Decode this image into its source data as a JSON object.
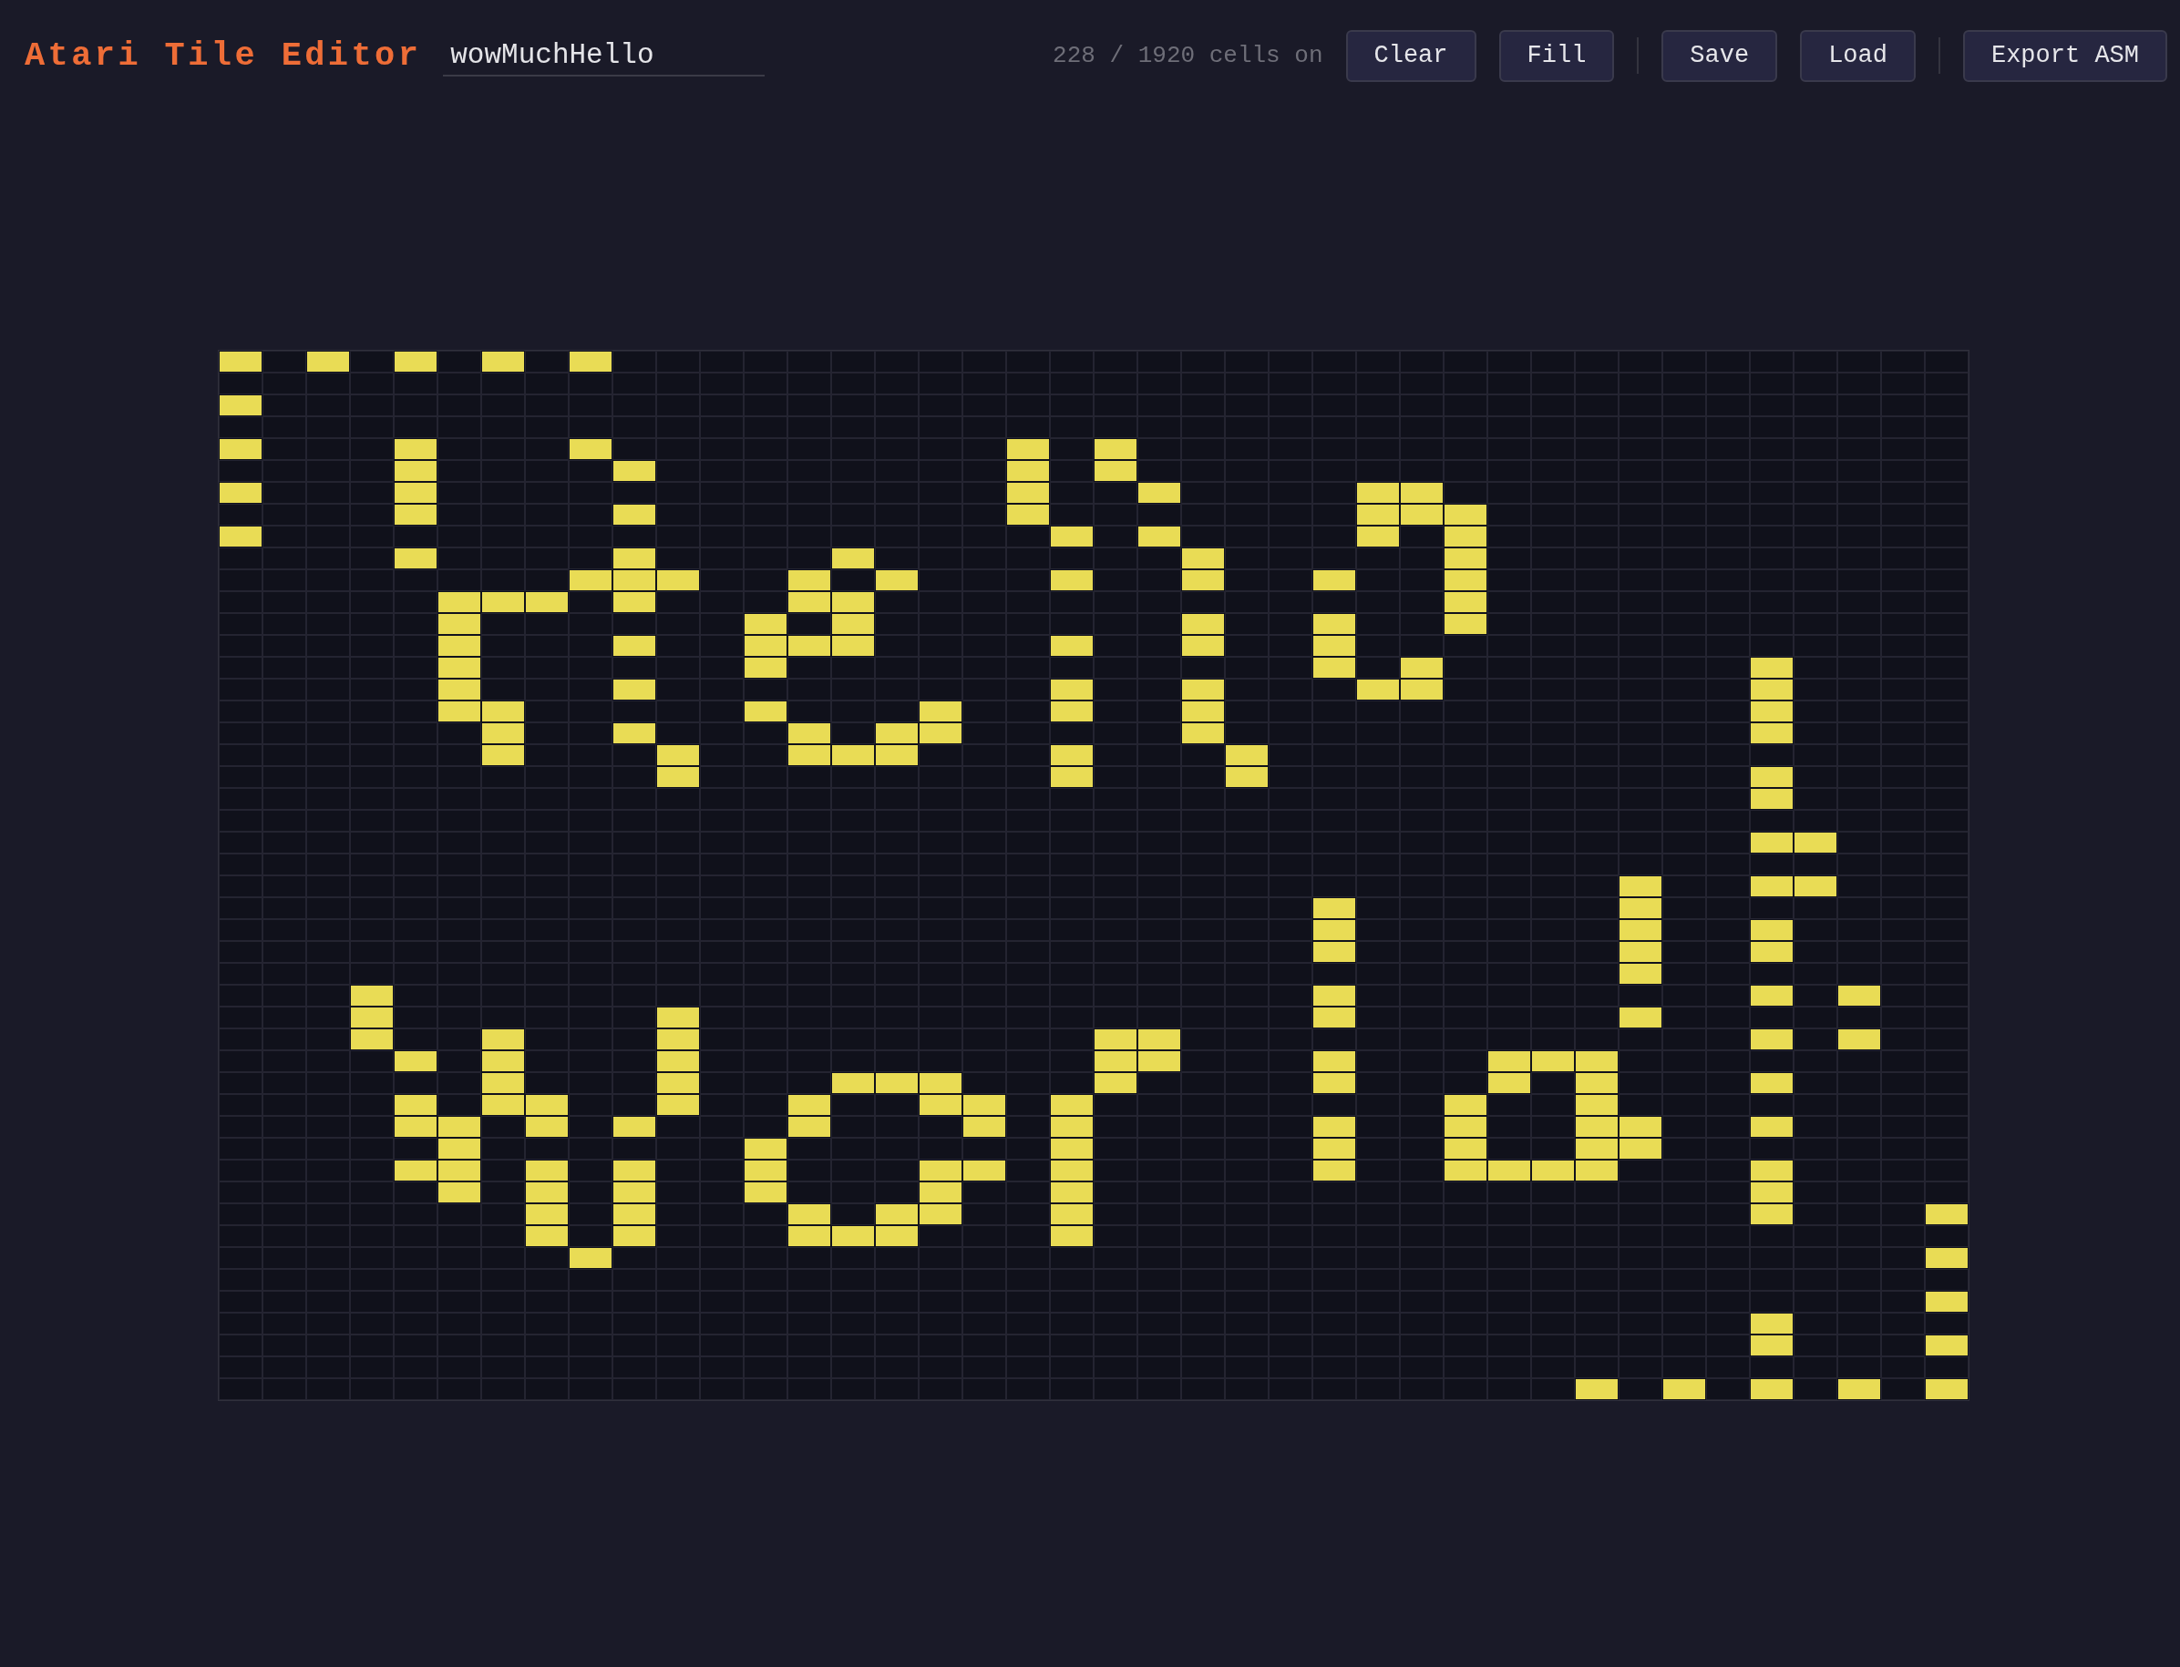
{
  "header": {
    "title": "Atari Tile Editor",
    "name_field": {
      "value": "wowMuchHello"
    },
    "cell_count": "228 / 1920 cells on",
    "toolbar_groups": [
      [
        "Clear",
        "Fill"
      ],
      [
        "Save",
        "Load"
      ],
      [
        "Export ASM"
      ]
    ]
  },
  "grid": {
    "cells": [
      [
        true,
        false,
        true,
        false,
        true,
        false,
        true,
        false,
        true,
        false,
        false,
        false,
        false,
        false,
        false,
        false,
        false,
        false,
        false,
        false,
        false,
        false,
        false,
        false,
        false,
        false,
        false,
        false,
        false,
        false,
        false,
        false,
        false,
        false,
        false,
        false,
        false,
        false,
        false,
        false
      ],
      [
        false,
        false,
        false,
        false,
        false,
        false,
        false,
        false,
        false,
        false,
        false,
        false,
        false,
        false,
        false,
        false,
        false,
        false,
        false,
        false,
        false,
        false,
        false,
        false,
        false,
        false,
        false,
        false,
        false,
        false,
        false,
        false,
        false,
        false,
        false,
        false,
        false,
        false,
        false,
        false
      ],
      [
        true,
        false,
        false,
        false,
        false,
        false,
        false,
        false,
        false,
        false,
        false,
        false,
        false,
        false,
        false,
        false,
        false,
        false,
        false,
        false,
        false,
        false,
        false,
        false,
        false,
        false,
        false,
        false,
        false,
        false,
        false,
        false,
        false,
        false,
        false,
        false,
        false,
        false,
        false,
        false
      ],
      [
        false,
        false,
        false,
        false,
        false,
        false,
        false,
        false,
        false,
        false,
        false,
        false,
        false,
        false,
        false,
        false,
        false,
        false,
        false,
        false,
        false,
        false,
        false,
        false,
        false,
        false,
        false,
        false,
        false,
        false,
        false,
        false,
        false,
        false,
        false,
        false,
        false,
        false,
        false,
        false
      ],
      [
        true,
        false,
        false,
        false,
        true,
        false,
        false,
        false,
        true,
        false,
        false,
        false,
        false,
        false,
        false,
        false,
        false,
        false,
        true,
        false,
        true,
        false,
        false,
        false,
        false,
        false,
        false,
        false,
        false,
        false,
        false,
        false,
        false,
        false,
        false,
        false,
        false,
        false,
        false,
        false
      ],
      [
        false,
        false,
        false,
        false,
        true,
        false,
        false,
        false,
        false,
        true,
        false,
        false,
        false,
        false,
        false,
        false,
        false,
        false,
        true,
        false,
        true,
        false,
        false,
        false,
        false,
        false,
        false,
        false,
        false,
        false,
        false,
        false,
        false,
        false,
        false,
        false,
        false,
        false,
        false,
        false
      ],
      [
        true,
        false,
        false,
        false,
        true,
        false,
        false,
        false,
        false,
        false,
        false,
        false,
        false,
        false,
        false,
        false,
        false,
        false,
        true,
        false,
        false,
        true,
        false,
        false,
        false,
        false,
        true,
        true,
        false,
        false,
        false,
        false,
        false,
        false,
        false,
        false,
        false,
        false,
        false,
        false
      ],
      [
        false,
        false,
        false,
        false,
        true,
        false,
        false,
        false,
        false,
        true,
        false,
        false,
        false,
        false,
        false,
        false,
        false,
        false,
        true,
        false,
        false,
        false,
        false,
        false,
        false,
        false,
        true,
        true,
        true,
        false,
        false,
        false,
        false,
        false,
        false,
        false,
        false,
        false,
        false,
        false
      ],
      [
        true,
        false,
        false,
        false,
        false,
        false,
        false,
        false,
        false,
        false,
        false,
        false,
        false,
        false,
        false,
        false,
        false,
        false,
        false,
        true,
        false,
        true,
        false,
        false,
        false,
        false,
        true,
        false,
        true,
        false,
        false,
        false,
        false,
        false,
        false,
        false,
        false,
        false,
        false,
        false
      ],
      [
        false,
        false,
        false,
        false,
        true,
        false,
        false,
        false,
        false,
        true,
        false,
        false,
        false,
        false,
        true,
        false,
        false,
        false,
        false,
        false,
        false,
        false,
        true,
        false,
        false,
        false,
        false,
        false,
        true,
        false,
        false,
        false,
        false,
        false,
        false,
        false,
        false,
        false,
        false,
        false
      ],
      [
        false,
        false,
        false,
        false,
        false,
        false,
        false,
        false,
        true,
        true,
        true,
        false,
        false,
        true,
        false,
        true,
        false,
        false,
        false,
        true,
        false,
        false,
        true,
        false,
        false,
        true,
        false,
        false,
        true,
        false,
        false,
        false,
        false,
        false,
        false,
        false,
        false,
        false,
        false,
        false
      ],
      [
        false,
        false,
        false,
        false,
        false,
        true,
        true,
        true,
        false,
        true,
        false,
        false,
        false,
        true,
        true,
        false,
        false,
        false,
        false,
        false,
        false,
        false,
        false,
        false,
        false,
        false,
        false,
        false,
        true,
        false,
        false,
        false,
        false,
        false,
        false,
        false,
        false,
        false,
        false,
        false
      ],
      [
        false,
        false,
        false,
        false,
        false,
        true,
        false,
        false,
        false,
        false,
        false,
        false,
        true,
        false,
        true,
        false,
        false,
        false,
        false,
        false,
        false,
        false,
        true,
        false,
        false,
        true,
        false,
        false,
        true,
        false,
        false,
        false,
        false,
        false,
        false,
        false,
        false,
        false,
        false,
        false
      ],
      [
        false,
        false,
        false,
        false,
        false,
        true,
        false,
        false,
        false,
        true,
        false,
        false,
        true,
        true,
        true,
        false,
        false,
        false,
        false,
        true,
        false,
        false,
        true,
        false,
        false,
        true,
        false,
        false,
        false,
        false,
        false,
        false,
        false,
        false,
        false,
        false,
        false,
        false,
        false,
        false
      ],
      [
        false,
        false,
        false,
        false,
        false,
        true,
        false,
        false,
        false,
        false,
        false,
        false,
        true,
        false,
        false,
        false,
        false,
        false,
        false,
        false,
        false,
        false,
        false,
        false,
        false,
        true,
        false,
        true,
        false,
        false,
        false,
        false,
        false,
        false,
        false,
        true,
        false,
        false,
        false,
        false
      ],
      [
        false,
        false,
        false,
        false,
        false,
        true,
        false,
        false,
        false,
        true,
        false,
        false,
        false,
        false,
        false,
        false,
        false,
        false,
        false,
        true,
        false,
        false,
        true,
        false,
        false,
        false,
        true,
        true,
        false,
        false,
        false,
        false,
        false,
        false,
        false,
        true,
        false,
        false,
        false,
        false
      ],
      [
        false,
        false,
        false,
        false,
        false,
        true,
        true,
        false,
        false,
        false,
        false,
        false,
        true,
        false,
        false,
        false,
        true,
        false,
        false,
        true,
        false,
        false,
        true,
        false,
        false,
        false,
        false,
        false,
        false,
        false,
        false,
        false,
        false,
        false,
        false,
        true,
        false,
        false,
        false,
        false
      ],
      [
        false,
        false,
        false,
        false,
        false,
        false,
        true,
        false,
        false,
        true,
        false,
        false,
        false,
        true,
        false,
        true,
        true,
        false,
        false,
        false,
        false,
        false,
        true,
        false,
        false,
        false,
        false,
        false,
        false,
        false,
        false,
        false,
        false,
        false,
        false,
        true,
        false,
        false,
        false,
        false
      ],
      [
        false,
        false,
        false,
        false,
        false,
        false,
        true,
        false,
        false,
        false,
        true,
        false,
        false,
        true,
        true,
        true,
        false,
        false,
        false,
        true,
        false,
        false,
        false,
        true,
        false,
        false,
        false,
        false,
        false,
        false,
        false,
        false,
        false,
        false,
        false,
        false,
        false,
        false,
        false,
        false
      ],
      [
        false,
        false,
        false,
        false,
        false,
        false,
        false,
        false,
        false,
        false,
        true,
        false,
        false,
        false,
        false,
        false,
        false,
        false,
        false,
        true,
        false,
        false,
        false,
        true,
        false,
        false,
        false,
        false,
        false,
        false,
        false,
        false,
        false,
        false,
        false,
        true,
        false,
        false,
        false,
        false
      ],
      [
        false,
        false,
        false,
        false,
        false,
        false,
        false,
        false,
        false,
        false,
        false,
        false,
        false,
        false,
        false,
        false,
        false,
        false,
        false,
        false,
        false,
        false,
        false,
        false,
        false,
        false,
        false,
        false,
        false,
        false,
        false,
        false,
        false,
        false,
        false,
        true,
        false,
        false,
        false,
        false
      ],
      [
        false,
        false,
        false,
        false,
        false,
        false,
        false,
        false,
        false,
        false,
        false,
        false,
        false,
        false,
        false,
        false,
        false,
        false,
        false,
        false,
        false,
        false,
        false,
        false,
        false,
        false,
        false,
        false,
        false,
        false,
        false,
        false,
        false,
        false,
        false,
        false,
        false,
        false,
        false,
        false
      ],
      [
        false,
        false,
        false,
        false,
        false,
        false,
        false,
        false,
        false,
        false,
        false,
        false,
        false,
        false,
        false,
        false,
        false,
        false,
        false,
        false,
        false,
        false,
        false,
        false,
        false,
        false,
        false,
        false,
        false,
        false,
        false,
        false,
        false,
        false,
        false,
        true,
        true,
        false,
        false,
        false
      ],
      [
        false,
        false,
        false,
        false,
        false,
        false,
        false,
        false,
        false,
        false,
        false,
        false,
        false,
        false,
        false,
        false,
        false,
        false,
        false,
        false,
        false,
        false,
        false,
        false,
        false,
        false,
        false,
        false,
        false,
        false,
        false,
        false,
        false,
        false,
        false,
        false,
        false,
        false,
        false,
        false
      ],
      [
        false,
        false,
        false,
        false,
        false,
        false,
        false,
        false,
        false,
        false,
        false,
        false,
        false,
        false,
        false,
        false,
        false,
        false,
        false,
        false,
        false,
        false,
        false,
        false,
        false,
        false,
        false,
        false,
        false,
        false,
        false,
        false,
        true,
        false,
        false,
        true,
        true,
        false,
        false,
        false
      ],
      [
        false,
        false,
        false,
        false,
        false,
        false,
        false,
        false,
        false,
        false,
        false,
        false,
        false,
        false,
        false,
        false,
        false,
        false,
        false,
        false,
        false,
        false,
        false,
        false,
        false,
        true,
        false,
        false,
        false,
        false,
        false,
        false,
        true,
        false,
        false,
        false,
        false,
        false,
        false,
        false
      ],
      [
        false,
        false,
        false,
        false,
        false,
        false,
        false,
        false,
        false,
        false,
        false,
        false,
        false,
        false,
        false,
        false,
        false,
        false,
        false,
        false,
        false,
        false,
        false,
        false,
        false,
        true,
        false,
        false,
        false,
        false,
        false,
        false,
        true,
        false,
        false,
        true,
        false,
        false,
        false,
        false
      ],
      [
        false,
        false,
        false,
        false,
        false,
        false,
        false,
        false,
        false,
        false,
        false,
        false,
        false,
        false,
        false,
        false,
        false,
        false,
        false,
        false,
        false,
        false,
        false,
        false,
        false,
        true,
        false,
        false,
        false,
        false,
        false,
        false,
        true,
        false,
        false,
        true,
        false,
        false,
        false,
        false
      ],
      [
        false,
        false,
        false,
        false,
        false,
        false,
        false,
        false,
        false,
        false,
        false,
        false,
        false,
        false,
        false,
        false,
        false,
        false,
        false,
        false,
        false,
        false,
        false,
        false,
        false,
        false,
        false,
        false,
        false,
        false,
        false,
        false,
        true,
        false,
        false,
        false,
        false,
        false,
        false,
        false
      ],
      [
        false,
        false,
        false,
        true,
        false,
        false,
        false,
        false,
        false,
        false,
        false,
        false,
        false,
        false,
        false,
        false,
        false,
        false,
        false,
        false,
        false,
        false,
        false,
        false,
        false,
        true,
        false,
        false,
        false,
        false,
        false,
        false,
        false,
        false,
        false,
        true,
        false,
        true,
        false,
        false
      ],
      [
        false,
        false,
        false,
        true,
        false,
        false,
        false,
        false,
        false,
        false,
        true,
        false,
        false,
        false,
        false,
        false,
        false,
        false,
        false,
        false,
        false,
        false,
        false,
        false,
        false,
        true,
        false,
        false,
        false,
        false,
        false,
        false,
        true,
        false,
        false,
        false,
        false,
        false,
        false,
        false
      ],
      [
        false,
        false,
        false,
        true,
        false,
        false,
        true,
        false,
        false,
        false,
        true,
        false,
        false,
        false,
        false,
        false,
        false,
        false,
        false,
        false,
        true,
        true,
        false,
        false,
        false,
        false,
        false,
        false,
        false,
        false,
        false,
        false,
        false,
        false,
        false,
        true,
        false,
        true,
        false,
        false
      ],
      [
        false,
        false,
        false,
        false,
        true,
        false,
        true,
        false,
        false,
        false,
        true,
        false,
        false,
        false,
        false,
        false,
        false,
        false,
        false,
        false,
        true,
        true,
        false,
        false,
        false,
        true,
        false,
        false,
        false,
        true,
        true,
        true,
        false,
        false,
        false,
        false,
        false,
        false,
        false,
        false
      ],
      [
        false,
        false,
        false,
        false,
        false,
        false,
        true,
        false,
        false,
        false,
        true,
        false,
        false,
        false,
        true,
        true,
        true,
        false,
        false,
        false,
        true,
        false,
        false,
        false,
        false,
        true,
        false,
        false,
        false,
        true,
        false,
        true,
        false,
        false,
        false,
        true,
        false,
        false,
        false,
        false
      ],
      [
        false,
        false,
        false,
        false,
        true,
        false,
        true,
        true,
        false,
        false,
        true,
        false,
        false,
        true,
        false,
        false,
        true,
        true,
        false,
        true,
        false,
        false,
        false,
        false,
        false,
        false,
        false,
        false,
        true,
        false,
        false,
        true,
        false,
        false,
        false,
        false,
        false,
        false,
        false,
        false
      ],
      [
        false,
        false,
        false,
        false,
        true,
        true,
        false,
        true,
        false,
        true,
        false,
        false,
        false,
        true,
        false,
        false,
        false,
        true,
        false,
        true,
        false,
        false,
        false,
        false,
        false,
        true,
        false,
        false,
        true,
        false,
        false,
        true,
        true,
        false,
        false,
        true,
        false,
        false,
        false,
        false
      ],
      [
        false,
        false,
        false,
        false,
        false,
        true,
        false,
        false,
        false,
        false,
        false,
        false,
        true,
        false,
        false,
        false,
        false,
        false,
        false,
        true,
        false,
        false,
        false,
        false,
        false,
        true,
        false,
        false,
        true,
        false,
        false,
        true,
        true,
        false,
        false,
        false,
        false,
        false,
        false,
        false
      ],
      [
        false,
        false,
        false,
        false,
        true,
        true,
        false,
        true,
        false,
        true,
        false,
        false,
        true,
        false,
        false,
        false,
        true,
        true,
        false,
        true,
        false,
        false,
        false,
        false,
        false,
        true,
        false,
        false,
        true,
        true,
        true,
        true,
        false,
        false,
        false,
        true,
        false,
        false,
        false,
        false
      ],
      [
        false,
        false,
        false,
        false,
        false,
        true,
        false,
        true,
        false,
        true,
        false,
        false,
        true,
        false,
        false,
        false,
        true,
        false,
        false,
        true,
        false,
        false,
        false,
        false,
        false,
        false,
        false,
        false,
        false,
        false,
        false,
        false,
        false,
        false,
        false,
        true,
        false,
        false,
        false,
        false
      ],
      [
        false,
        false,
        false,
        false,
        false,
        false,
        false,
        true,
        false,
        true,
        false,
        false,
        false,
        true,
        false,
        true,
        true,
        false,
        false,
        true,
        false,
        false,
        false,
        false,
        false,
        false,
        false,
        false,
        false,
        false,
        false,
        false,
        false,
        false,
        false,
        true,
        false,
        false,
        false,
        true
      ],
      [
        false,
        false,
        false,
        false,
        false,
        false,
        false,
        true,
        false,
        true,
        false,
        false,
        false,
        true,
        true,
        true,
        false,
        false,
        false,
        true,
        false,
        false,
        false,
        false,
        false,
        false,
        false,
        false,
        false,
        false,
        false,
        false,
        false,
        false,
        false,
        false,
        false,
        false,
        false,
        false
      ],
      [
        false,
        false,
        false,
        false,
        false,
        false,
        false,
        false,
        true,
        false,
        false,
        false,
        false,
        false,
        false,
        false,
        false,
        false,
        false,
        false,
        false,
        false,
        false,
        false,
        false,
        false,
        false,
        false,
        false,
        false,
        false,
        false,
        false,
        false,
        false,
        false,
        false,
        false,
        false,
        true
      ],
      [
        false,
        false,
        false,
        false,
        false,
        false,
        false,
        false,
        false,
        false,
        false,
        false,
        false,
        false,
        false,
        false,
        false,
        false,
        false,
        false,
        false,
        false,
        false,
        false,
        false,
        false,
        false,
        false,
        false,
        false,
        false,
        false,
        false,
        false,
        false,
        false,
        false,
        false,
        false,
        false
      ],
      [
        false,
        false,
        false,
        false,
        false,
        false,
        false,
        false,
        false,
        false,
        false,
        false,
        false,
        false,
        false,
        false,
        false,
        false,
        false,
        false,
        false,
        false,
        false,
        false,
        false,
        false,
        false,
        false,
        false,
        false,
        false,
        false,
        false,
        false,
        false,
        false,
        false,
        false,
        false,
        true
      ],
      [
        false,
        false,
        false,
        false,
        false,
        false,
        false,
        false,
        false,
        false,
        false,
        false,
        false,
        false,
        false,
        false,
        false,
        false,
        false,
        false,
        false,
        false,
        false,
        false,
        false,
        false,
        false,
        false,
        false,
        false,
        false,
        false,
        false,
        false,
        false,
        true,
        false,
        false,
        false,
        false
      ],
      [
        false,
        false,
        false,
        false,
        false,
        false,
        false,
        false,
        false,
        false,
        false,
        false,
        false,
        false,
        false,
        false,
        false,
        false,
        false,
        false,
        false,
        false,
        false,
        false,
        false,
        false,
        false,
        false,
        false,
        false,
        false,
        false,
        false,
        false,
        false,
        true,
        false,
        false,
        false,
        true
      ],
      [
        false,
        false,
        false,
        false,
        false,
        false,
        false,
        false,
        false,
        false,
        false,
        false,
        false,
        false,
        false,
        false,
        false,
        false,
        false,
        false,
        false,
        false,
        false,
        false,
        false,
        false,
        false,
        false,
        false,
        false,
        false,
        false,
        false,
        false,
        false,
        false,
        false,
        false,
        false,
        false
      ],
      [
        false,
        false,
        false,
        false,
        false,
        false,
        false,
        false,
        false,
        false,
        false,
        false,
        false,
        false,
        false,
        false,
        false,
        false,
        false,
        false,
        false,
        false,
        false,
        false,
        false,
        false,
        false,
        false,
        false,
        false,
        false,
        true,
        false,
        true,
        false,
        true,
        false,
        true,
        false,
        true
      ]
    ]
  }
}
